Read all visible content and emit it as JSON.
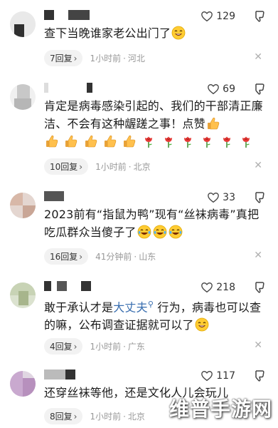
{
  "comments": [
    {
      "likes": "129",
      "text": "查下当晚谁家老公出门了",
      "reply": "7回复",
      "time": "1小时前",
      "location": "河北"
    },
    {
      "likes": "69",
      "text": "肯定是病毒感染引起的、我们的干部清正廉洁、不会有这种龌蹉之事！点赞",
      "reply": "10回复",
      "time": "1小时前",
      "location": "北京"
    },
    {
      "likes": "33",
      "text": "2023前有“指鼠为鸭”现有“丝袜病毒”真把吃瓜群众当傻子了",
      "reply": "16回复",
      "time": "41分钟前",
      "location": "山东"
    },
    {
      "likes": "218",
      "text_a": "敢于承认才是",
      "text_link": "大丈夫",
      "text_b": " 行为，病毒也可以查的嘛，公布调查证据就可以了",
      "reply": "4回复",
      "time": "1小时前",
      "location": "广东"
    },
    {
      "likes": "117",
      "text": "还穿丝袜等他，还是文化人儿会玩儿",
      "reply": "8回复",
      "time": "1小时前",
      "location": "北京"
    }
  ],
  "separator": "·",
  "close_glyph": "✕",
  "watermark": "维普手游网",
  "icons": {
    "like": "thumbs-up-outline-icon",
    "dislike": "thumbs-down-outline-icon",
    "emoji_laugh": "grinning-face-icon",
    "emoji_thumb": "thumbs-up-emoji-icon",
    "emoji_rose": "rose-emoji-icon",
    "emoji_tears": "tears-of-joy-icon",
    "search": "search-icon"
  },
  "colors": {
    "link": "#3a6fb0",
    "meta": "#999999",
    "pill_bg": "#f2f2f2"
  }
}
